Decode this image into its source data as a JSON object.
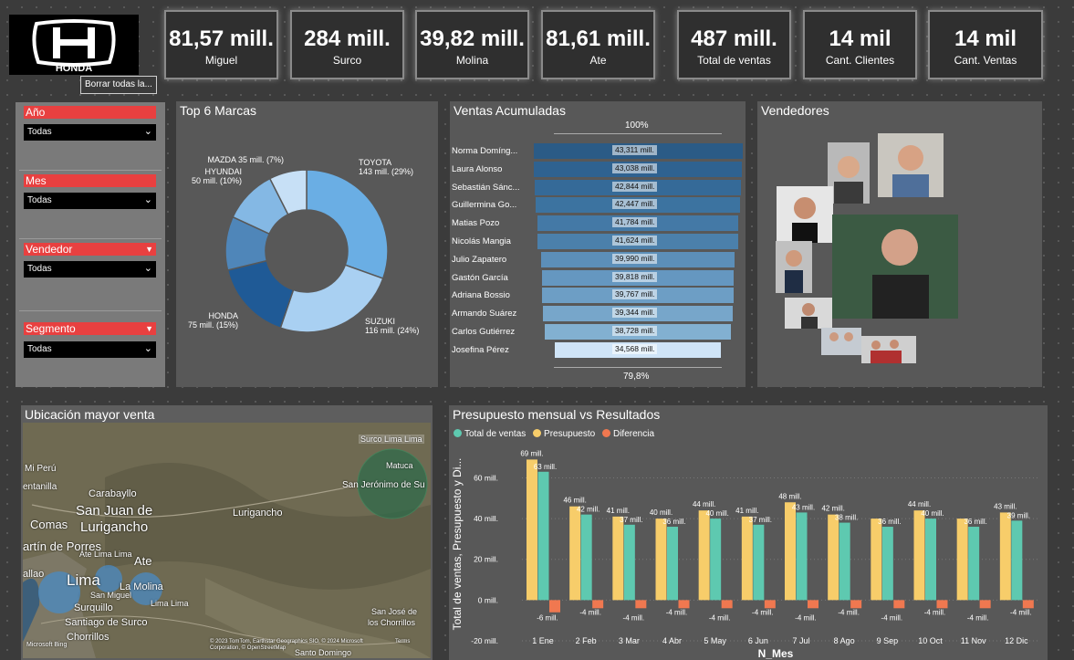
{
  "brand": {
    "name": "HONDA"
  },
  "clear_filters_label": "Borrar todas la...",
  "kpis": [
    {
      "value": "81,57 mill.",
      "label": "Miguel"
    },
    {
      "value": "284 mill.",
      "label": "Surco"
    },
    {
      "value": "39,82 mill.",
      "label": "Molina"
    },
    {
      "value": "81,61 mill.",
      "label": "Ate"
    },
    {
      "value": "487 mill.",
      "label": "Total de ventas"
    },
    {
      "value": "14 mil",
      "label": "Cant. Clientes"
    },
    {
      "value": "14 mil",
      "label": "Cant. Ventas"
    }
  ],
  "slicers": [
    {
      "label": "Año",
      "value": "Todas"
    },
    {
      "label": "Mes",
      "value": "Todas"
    },
    {
      "label": "Vendedor",
      "value": "Todas"
    },
    {
      "label": "Segmento",
      "value": "Todas"
    }
  ],
  "top_marcas": {
    "title": "Top 6 Marcas",
    "slices": [
      {
        "name": "TOYOTA",
        "value_label": "143 mill. (29%)",
        "value": 143,
        "color": "#6aaee4"
      },
      {
        "name": "SUZUKI",
        "value_label": "116 mill. (24%)",
        "value": 116,
        "color": "#a9d0f2"
      },
      {
        "name": "HONDA",
        "value_label": "75 mill. (15%)",
        "value": 75,
        "color": "#1f5a96"
      },
      {
        "name": "",
        "value_label": "",
        "value": 50,
        "color": "#4f86b9"
      },
      {
        "name": "HYUNDAI",
        "value_label": "50 mill. (10%)",
        "value": 50,
        "color": "#84b8e4"
      },
      {
        "name": "MAZDA",
        "value_label": "35 mill. (7%)",
        "value": 35,
        "color": "#c7e0f6"
      }
    ]
  },
  "ventas_acumuladas": {
    "title": "Ventas Acumuladas",
    "top_pct": "100%",
    "bottom_pct": "79,8%",
    "rows": [
      {
        "name": "Norma Domíng...",
        "value": 43311,
        "value_label": "43,311 mill."
      },
      {
        "name": "Laura Alonso",
        "value": 43038,
        "value_label": "43,038 mill."
      },
      {
        "name": "Sebastián Sánc...",
        "value": 42844,
        "value_label": "42,844 mill."
      },
      {
        "name": "Guillermina Go...",
        "value": 42447,
        "value_label": "42,447 mill."
      },
      {
        "name": "Matias Pozo",
        "value": 41784,
        "value_label": "41,784 mill."
      },
      {
        "name": "Nicolás Mangia",
        "value": 41624,
        "value_label": "41,624 mill."
      },
      {
        "name": "Julio Zapatero",
        "value": 39990,
        "value_label": "39,990 mill."
      },
      {
        "name": "Gastón García",
        "value": 39818,
        "value_label": "39,818 mill."
      },
      {
        "name": "Adriana Bossio",
        "value": 39767,
        "value_label": "39,767 mill."
      },
      {
        "name": "Armando Suárez",
        "value": 39344,
        "value_label": "39,344 mill."
      },
      {
        "name": "Carlos Gutiérrez",
        "value": 38728,
        "value_label": "38,728 mill."
      },
      {
        "name": "Josefina Pérez",
        "value": 34568,
        "value_label": "34,568 mill."
      }
    ]
  },
  "vendedores": {
    "title": "Vendedores"
  },
  "mapa": {
    "title": "Ubicación mayor venta",
    "places": [
      "Surco Lima Lima",
      "Matuca",
      "San Jerónimo de Su",
      "Mi Perú",
      "Carabayllo",
      "entanilla",
      "San Juan de",
      "Lurigancho",
      "Comas",
      "Lurigancho",
      "artín de Porres",
      "Ate Lima Lima",
      "Ate",
      "allao",
      "Lima",
      "La Molina",
      "San Miguel",
      "Lima Lima",
      "Surquillo",
      "Santiago de Surco",
      "Chorrillos",
      "San José de",
      "los Chorrillos",
      "Santo Domingo"
    ],
    "attribution_brand": "Microsoft Bing",
    "attribution": "© 2023 TomTom, Earthstar Geographics SIO, © 2024 Microsoft Corporation, © OpenStreetMap",
    "terms": "Terms"
  },
  "presupuesto": {
    "title": "Presupuesto mensual vs Resultados",
    "legend": [
      {
        "name": "Total de ventas",
        "color": "#5ec9b0"
      },
      {
        "name": "Presupuesto",
        "color": "#f7cd6a"
      },
      {
        "name": "Diferencia",
        "color": "#f07850"
      }
    ],
    "ylabel": "Total de ventas, Presupuesto y Di...",
    "xlabel": "N_Mes",
    "yticks": [
      "-20 mill.",
      "0 mill.",
      "20 mill.",
      "40 mill.",
      "60 mill."
    ]
  },
  "chart_data": {
    "type": "bar",
    "title": "Presupuesto mensual vs Resultados",
    "xlabel": "N_Mes",
    "ylabel": "Total de ventas, Presupuesto y Di...",
    "ylim": [
      -20,
      75
    ],
    "categories": [
      "1 Ene",
      "2 Feb",
      "3 Mar",
      "4 Abr",
      "5 May",
      "6 Jun",
      "7 Jul",
      "8 Ago",
      "9 Sep",
      "10 Oct",
      "11 Nov",
      "12 Dic"
    ],
    "series": [
      {
        "name": "Presupuesto",
        "values": [
          69,
          46,
          41,
          40,
          44,
          41,
          48,
          42,
          40,
          44,
          40,
          43
        ],
        "labels": [
          "69 mill.",
          "46 mill.",
          "41 mill.",
          "40 mill.",
          "44 mill.",
          "41 mill.",
          "48 mill.",
          "42 mill.",
          "",
          "44 mill.",
          "",
          "43 mill."
        ]
      },
      {
        "name": "Total de ventas",
        "values": [
          63,
          42,
          37,
          36,
          40,
          37,
          43,
          38,
          36,
          40,
          36,
          39
        ],
        "labels": [
          "63 mill.",
          "42 mill.",
          "37 mill.",
          "36 mill.",
          "40 mill.",
          "37 mill.",
          "43 mill.",
          "38 mill.",
          "36 mill.",
          "40 mill.",
          "36 mill.",
          "39 mill."
        ]
      },
      {
        "name": "Diferencia",
        "values": [
          -6,
          -4,
          -4,
          -4,
          -4,
          -4,
          -4,
          -4,
          -4,
          -4,
          -4,
          -4
        ],
        "labels": [
          "-6 mill.",
          "-4 mill.",
          "-4 mill.",
          "-4 mill.",
          "-4 mill.",
          "-4 mill.",
          "-4 mill.",
          "-4 mill.",
          "-4 mill.",
          "-4 mill.",
          "-4 mill.",
          "-4 mill."
        ]
      }
    ]
  }
}
